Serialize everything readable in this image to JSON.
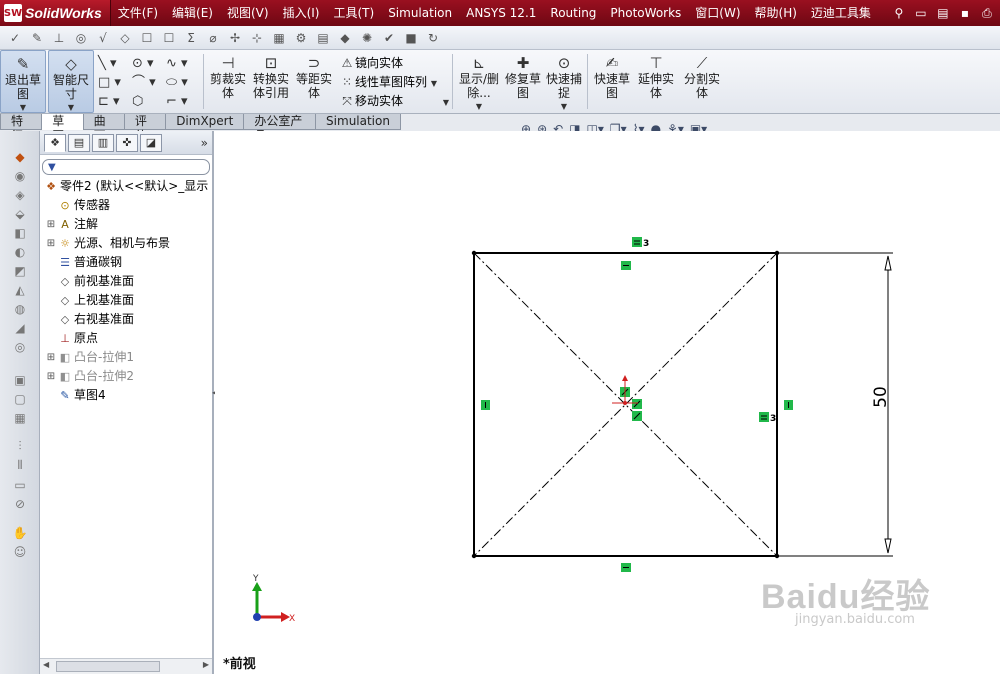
{
  "app": {
    "logo_badge": "SW",
    "brand": "SolidWorks"
  },
  "menus": [
    "文件(F)",
    "编辑(E)",
    "视图(V)",
    "插入(I)",
    "工具(T)",
    "Simulation",
    "ANSYS 12.1",
    "Routing",
    "PhotoWorks",
    "窗口(W)",
    "帮助(H)",
    "迈迪工具集"
  ],
  "commands": {
    "exit_sketch": "退出草图",
    "smart_dim": "智能尺寸",
    "trim": "剪裁实体",
    "convert": "转换实体引用",
    "offset": "等距实体",
    "mirror": "镜向实体",
    "linear_pattern": "线性草图阵列",
    "move": "移动实体",
    "display_delete": "显示/删除...",
    "repair": "修复草图",
    "quick_snaps": "快速捕捉",
    "rapid_sketch": "快速草图",
    "extend": "延伸实体",
    "split": "分割实体"
  },
  "tabs": [
    "特征",
    "草图",
    "曲面",
    "评估",
    "DimXpert",
    "办公室产品",
    "Simulation"
  ],
  "active_tab": "草图",
  "feature_tree": {
    "root": "零件2 (默认<<默认>_显示",
    "items": [
      {
        "label": "传感器",
        "icon": "sensor-icon",
        "expandable": false,
        "dim": false
      },
      {
        "label": "注解",
        "icon": "annotation-icon",
        "expandable": true,
        "dim": false
      },
      {
        "label": "光源、相机与布景",
        "icon": "lights-icon",
        "expandable": true,
        "dim": false
      },
      {
        "label": "普通碳钢",
        "icon": "material-icon",
        "expandable": false,
        "dim": false
      },
      {
        "label": "前视基准面",
        "icon": "plane-icon",
        "expandable": false,
        "dim": false
      },
      {
        "label": "上视基准面",
        "icon": "plane-icon",
        "expandable": false,
        "dim": false
      },
      {
        "label": "右视基准面",
        "icon": "plane-icon",
        "expandable": false,
        "dim": false
      },
      {
        "label": "原点",
        "icon": "origin-icon",
        "expandable": false,
        "dim": false
      },
      {
        "label": "凸台-拉伸1",
        "icon": "extrude-icon",
        "expandable": true,
        "dim": true
      },
      {
        "label": "凸台-拉伸2",
        "icon": "extrude-icon",
        "expandable": true,
        "dim": true
      },
      {
        "label": "草图4",
        "icon": "sketch-icon",
        "expandable": false,
        "dim": false
      }
    ]
  },
  "canvas": {
    "view_label": "*前视",
    "dimension_value": "50",
    "relation_count_top": "3",
    "relation_count_right": "3",
    "axis_x": "X",
    "axis_y": "Y"
  },
  "watermark": {
    "main": "Baidu经验",
    "url": "jingyan.baidu.com"
  },
  "colors": {
    "menubar": "#8e0e1c",
    "relation_marker": "#21b84a",
    "sketch_line": "#000000",
    "axis_x": "#d02020",
    "axis_y": "#18a018"
  }
}
